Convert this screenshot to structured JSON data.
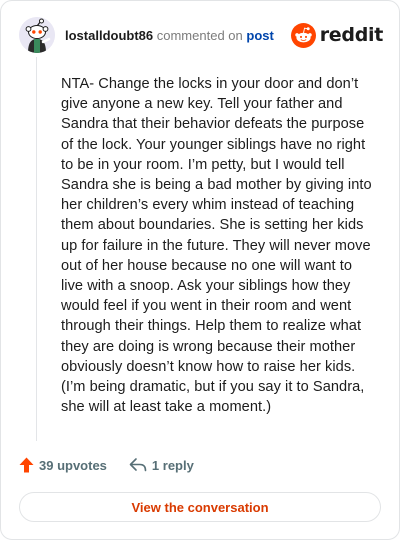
{
  "header": {
    "username": "lostalldoubt86",
    "action_text": "commented on",
    "post_link": "post",
    "avatar_icon": "snoo-avatar-icon",
    "logo_icon": "reddit-snoo-icon",
    "logo_text": "reddit"
  },
  "comment": {
    "body": "NTA- Change the locks in your door and don’t give anyone a new key. Tell your father and Sandra that their behavior defeats the purpose of the lock. Your younger siblings have no right to be in your room. I’m petty, but I would tell Sandra she is being a bad mother by giving into her children’s every whim instead of teaching them about boundaries. She is setting her kids up for failure in the future. They will never move out of her house because no one will want to live with a snoop. Ask your siblings how they would feel if you went in their room and went through their things. Help them to realize what they are doing is wrong because their mother obviously doesn’t know how to raise her kids. (I’m being dramatic, but if you say it to Sandra, she will at least take a moment.)"
  },
  "actions": {
    "upvotes": "39 upvotes",
    "upvote_icon": "upvote-arrow-icon",
    "replies": "1 reply",
    "reply_icon": "reply-arrow-icon"
  },
  "cta": {
    "label": "View the conversation"
  },
  "colors": {
    "brand": "#ff4500",
    "cta_text": "#d93a00",
    "link": "#0045ac",
    "muted": "#576f76"
  }
}
